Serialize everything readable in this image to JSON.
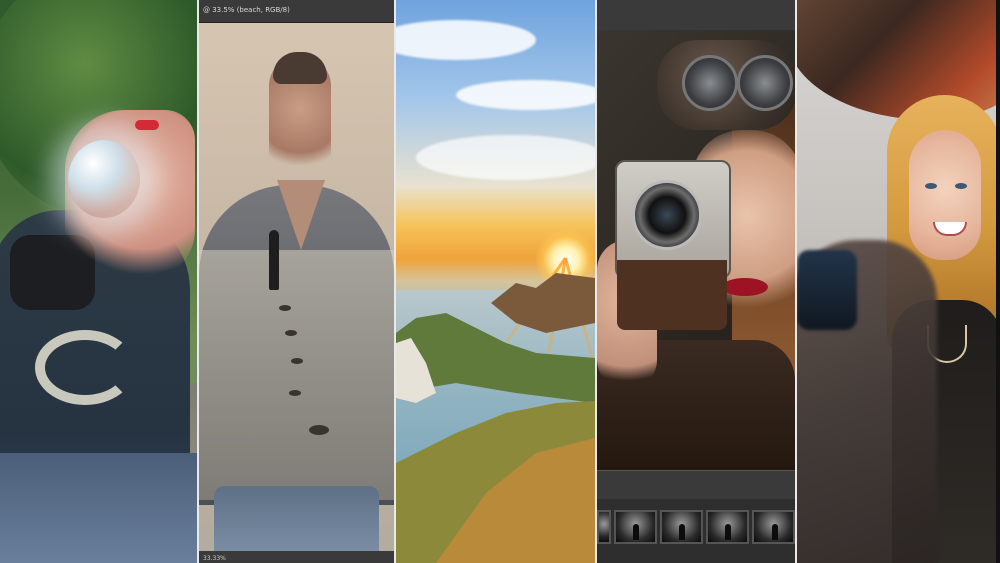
{
  "panels": {
    "water_balloon": {},
    "double_exposure": {
      "document_tab": "@ 33.5% (beach, RGB/8)",
      "status_bar": "33.33%"
    },
    "sunset_landscape": {},
    "retro_camera": {},
    "blonde_portrait": {}
  },
  "colors": {
    "divider": "#e9e9e9",
    "app_chrome": "#3a3a3a"
  }
}
